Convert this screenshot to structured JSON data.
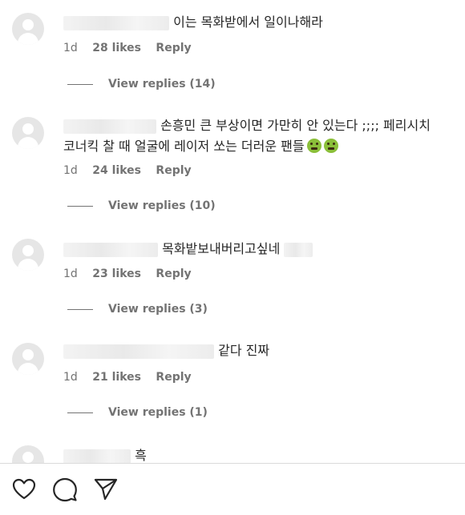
{
  "comments": [
    {
      "username": "",
      "text": "이는 목화받에서 일이나해라",
      "time": "1d",
      "likes": "28 likes",
      "reply": "Reply",
      "view_replies": "View replies (14)"
    },
    {
      "username": "",
      "text": "손흥민 큰 부상이면 가만히 안 있는다 ;;;; 페리시치 코너킥 찰 때 얼굴에 레이저 쏘는 더러운 팬들",
      "time": "1d",
      "likes": "24 likes",
      "reply": "Reply",
      "view_replies": "View replies (10)"
    },
    {
      "username": "",
      "text": "목화밭보내버리고싶네",
      "time": "1d",
      "likes": "23 likes",
      "reply": "Reply",
      "view_replies": "View replies (3)"
    },
    {
      "username": "",
      "text": "같다 진짜",
      "time": "1d",
      "likes": "21 likes",
      "reply": "Reply",
      "view_replies": "View replies (1)"
    },
    {
      "username": "",
      "text": "흑"
    }
  ],
  "icons": {
    "like": "heart-icon",
    "comment": "comment-icon",
    "share": "send-icon"
  }
}
